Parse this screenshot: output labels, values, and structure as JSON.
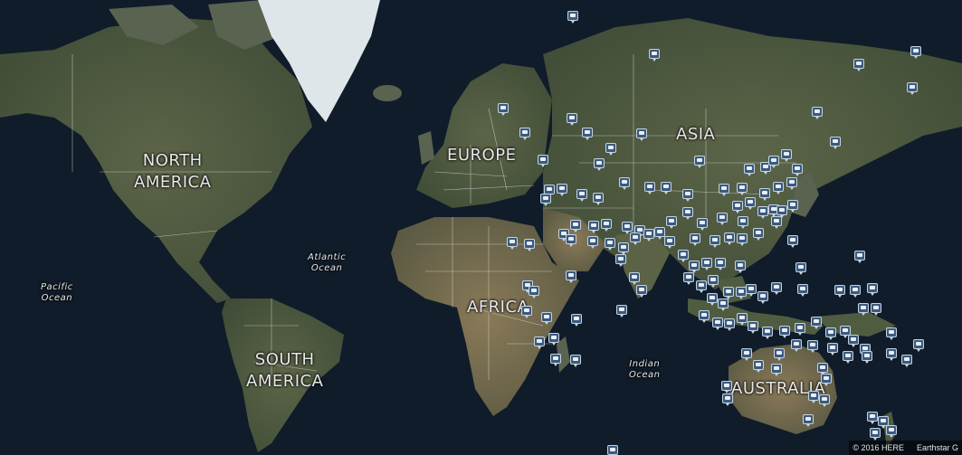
{
  "map": {
    "continents": {
      "north_america": [
        "NORTH",
        "AMERICA"
      ],
      "south_america": [
        "SOUTH",
        "AMERICA"
      ],
      "europe": "EUROPE",
      "asia": "ASIA",
      "africa": "AFRICA",
      "australia": "AUSTRALIA"
    },
    "oceans": {
      "pacific": [
        "Pacific",
        "Ocean"
      ],
      "atlantic": [
        "Atlantic",
        "Ocean"
      ],
      "indian": [
        "Indian",
        "Ocean"
      ]
    },
    "marker_icon": "camera-icon",
    "colors": {
      "ocean": "#0f1b28",
      "land": "#4d5a3e",
      "marker_fill": "#3c5a7d",
      "marker_border": "#c5d3e2",
      "ice": "#dfe6ea"
    }
  },
  "attribution": {
    "copyright": "© 2016 HERE",
    "imagery": "Earthstar G"
  }
}
